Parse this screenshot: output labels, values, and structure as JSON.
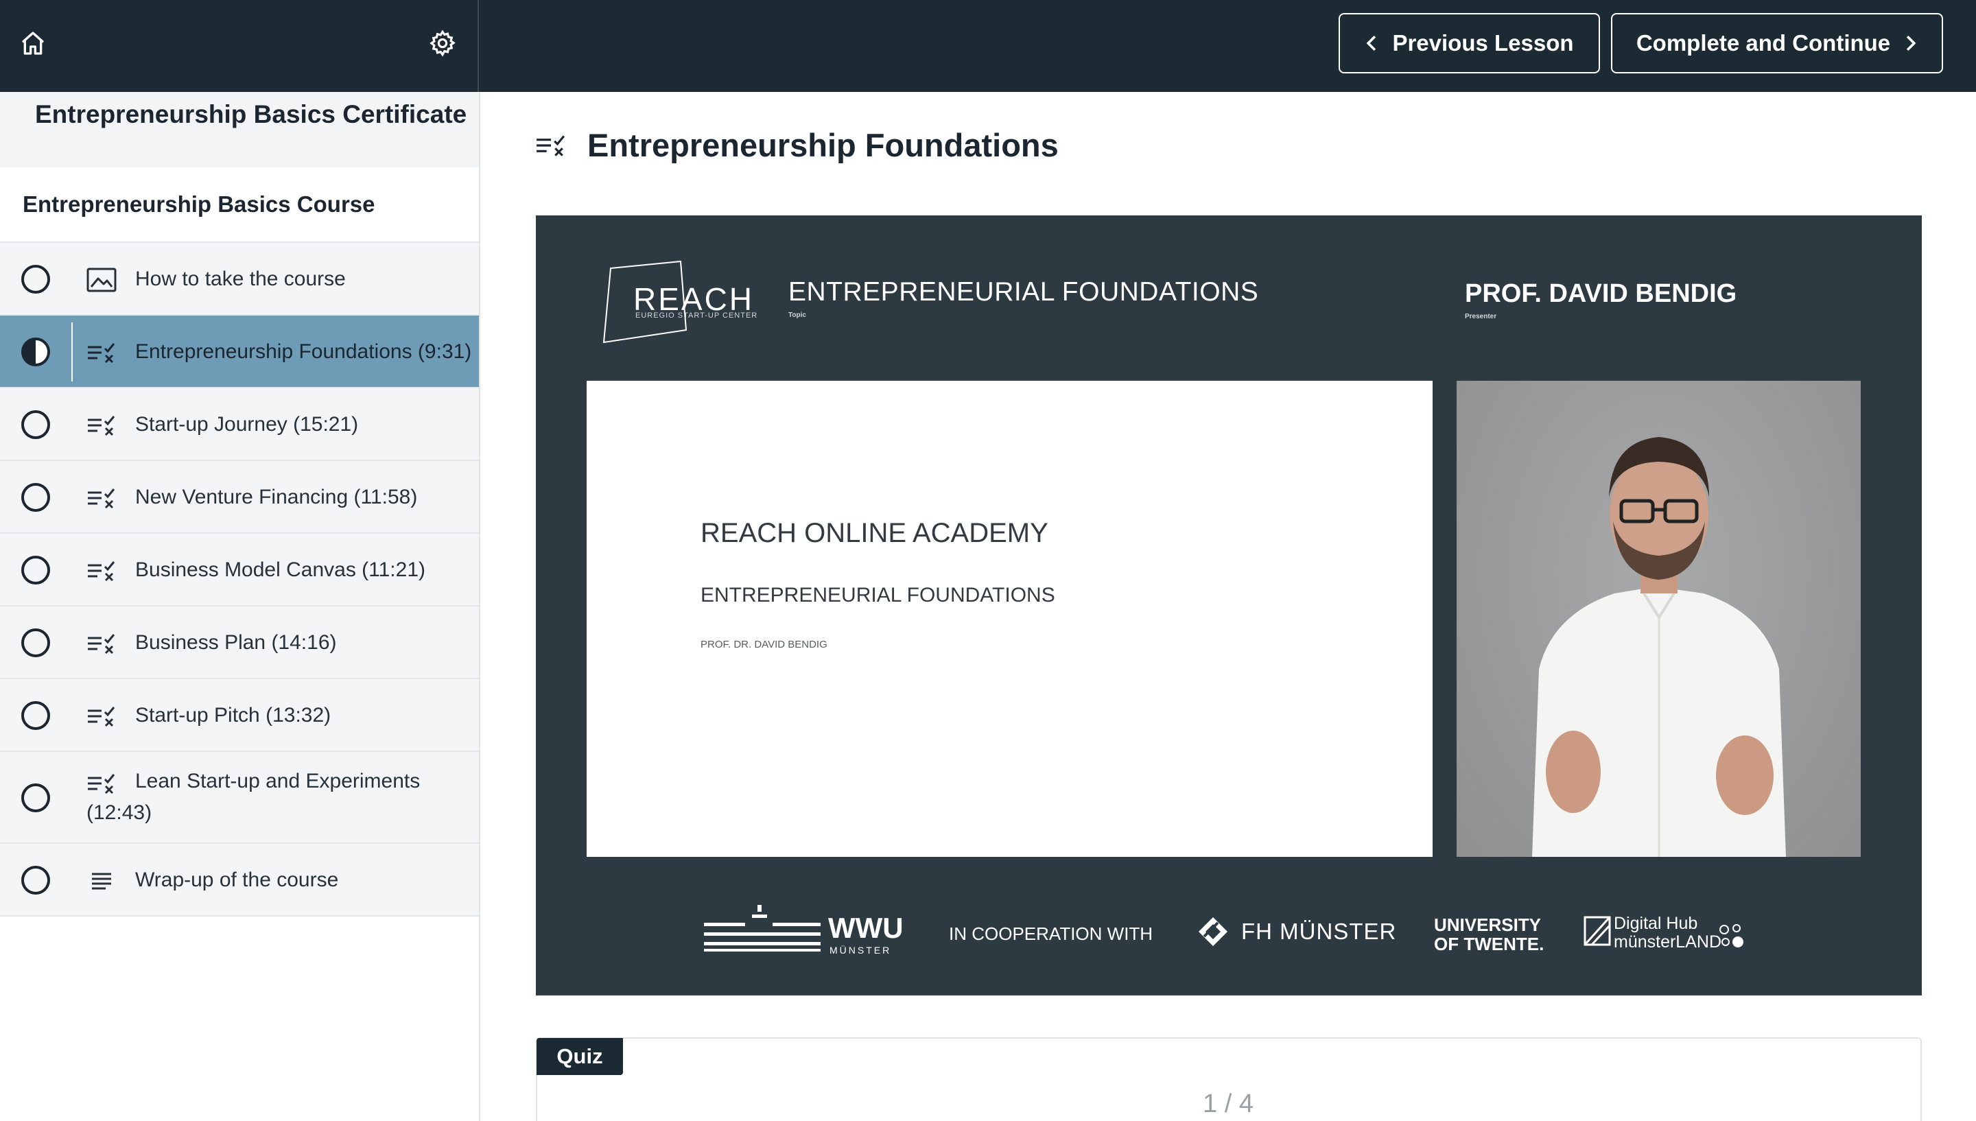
{
  "header": {
    "prev_label": "Previous Lesson",
    "next_label": "Complete and Continue",
    "home_icon": "home-icon",
    "settings_icon": "gear-icon"
  },
  "sidebar": {
    "certificate_title": "Entrepreneurship Basics Certificate",
    "course_title": "Entrepreneurship Basics Course",
    "lessons": [
      {
        "title": "How to take the course",
        "type": "image",
        "status": "not-started"
      },
      {
        "title": "Entrepreneurship Foundations (9:31)",
        "type": "quiz",
        "status": "in-progress"
      },
      {
        "title": "Start-up Journey (15:21)",
        "type": "quiz",
        "status": "not-started"
      },
      {
        "title": "New Venture Financing (11:58)",
        "type": "quiz",
        "status": "not-started"
      },
      {
        "title": "Business Model Canvas (11:21)",
        "type": "quiz",
        "status": "not-started"
      },
      {
        "title": "Business Plan (14:16)",
        "type": "quiz",
        "status": "not-started"
      },
      {
        "title": "Start-up Pitch (13:32)",
        "type": "quiz",
        "status": "not-started"
      },
      {
        "title": "Lean Start-up and Experiments (12:43)",
        "type": "quiz",
        "status": "not-started"
      },
      {
        "title": "Wrap-up of the course",
        "type": "text",
        "status": "not-started"
      }
    ]
  },
  "main": {
    "lesson_title": "Entrepreneurship Foundations",
    "video": {
      "logo_text": "REACH",
      "logo_subtext": "EUREGIO START-UP CENTER",
      "topic": "ENTREPRENEURIAL FOUNDATIONS",
      "topic_label": "Topic",
      "presenter": "PROF. DAVID BENDIG",
      "presenter_label": "Presenter",
      "slide_title": "REACH ONLINE ACADEMY",
      "slide_subtitle": "ENTREPRENEURIAL FOUNDATIONS",
      "slide_author": "PROF. DR. DAVID BENDIG",
      "partner_wwu": "WWU",
      "partner_wwu_sub": "MÜNSTER",
      "cooperation": "IN COOPERATION WITH",
      "partner_fh": "FH MÜNSTER",
      "partner_ut_line1": "UNIVERSITY",
      "partner_ut_line2": "OF TWENTE.",
      "partner_dh_line1": "Digital Hub",
      "partner_dh_line2": "münsterLAND"
    },
    "quiz": {
      "label": "Quiz",
      "progress": "1 / 4"
    }
  },
  "colors": {
    "header_bg": "#1c2a33",
    "active_lesson_bg": "#6e9bb6",
    "video_bg": "#2d3a42"
  }
}
